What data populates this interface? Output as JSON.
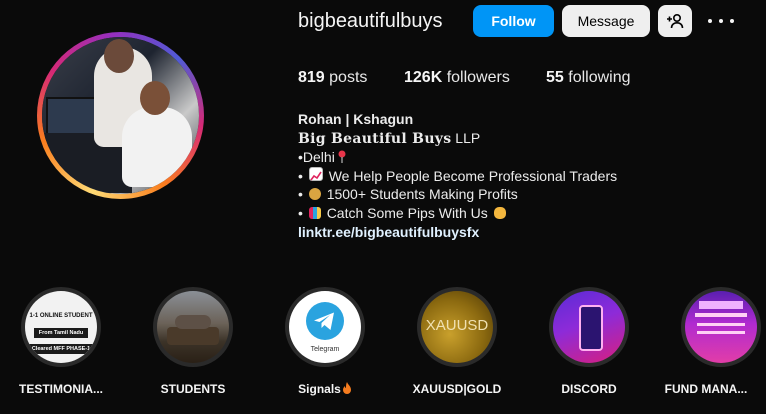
{
  "profile": {
    "username": "bigbeautifulbuys",
    "follow_label": "Follow",
    "message_label": "Message",
    "posts_count": "819",
    "posts_label": "posts",
    "followers_count": "126K",
    "followers_label": "followers",
    "following_count": "55",
    "following_label": "following"
  },
  "bio": {
    "name": "Rohan | Kshagun",
    "brand": "Big Beautiful Buys",
    "brand_suffix": " LLP",
    "line_delhi": "•Delhi",
    "line_help": "We Help People Become Professional Traders",
    "line_students": "1500+ Students Making Profits",
    "line_pips": "Catch Some Pips With Us",
    "link": "linktr.ee/bigbeautifulbuysfx"
  },
  "highlights": [
    {
      "label": "TESTIMONIA...",
      "line1": "1-1 ONLINE STUDENT",
      "line2": "From Tamil Nadu",
      "line3": "Cleared MFF PHASE-1"
    },
    {
      "label": "STUDENTS"
    },
    {
      "label": "Signals",
      "caption": "Telegram"
    },
    {
      "label": "XAUUSD|GOLD",
      "art_text": "XAUUSD"
    },
    {
      "label": "DISCORD"
    },
    {
      "label": "FUND MANA..."
    }
  ],
  "icons": {
    "suggest": "add-person-icon",
    "more": "more-options-icon",
    "telegram": "telegram-icon",
    "fire": "fire-emoji-icon"
  },
  "colors": {
    "follow": "#0095f6",
    "background": "#0a0a0a",
    "telegram": "#2aa3df"
  }
}
